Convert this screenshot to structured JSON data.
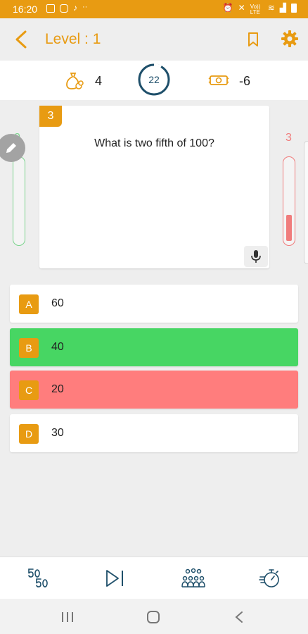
{
  "status_bar": {
    "time": "16:20",
    "right_text": "Vo)) LTE"
  },
  "header": {
    "title": "Level : 1"
  },
  "stats": {
    "coins": "4",
    "timer": "22",
    "timer_progress": 0.08,
    "money": "-6"
  },
  "progress": {
    "correct": "0",
    "wrong": "3",
    "wrong_fill": 0.3
  },
  "question": {
    "number": "3",
    "text": "What is two fifth of 100?"
  },
  "options": [
    {
      "letter": "A",
      "text": "60",
      "state": "normal"
    },
    {
      "letter": "B",
      "text": "40",
      "state": "correct"
    },
    {
      "letter": "C",
      "text": "20",
      "state": "wrong"
    },
    {
      "letter": "D",
      "text": "30",
      "state": "normal"
    }
  ],
  "lifelines": {
    "fifty_fifty": "fifty-fifty-icon",
    "skip": "skip-icon",
    "audience": "audience-icon",
    "time": "timer-icon"
  },
  "colors": {
    "accent": "#e89b12",
    "correct": "#47d663",
    "wrong": "#ff7d7d",
    "correct_outline": "#7bd48d",
    "wrong_outline": "#f07c7c",
    "timer_ring": "#1e4f6a"
  }
}
